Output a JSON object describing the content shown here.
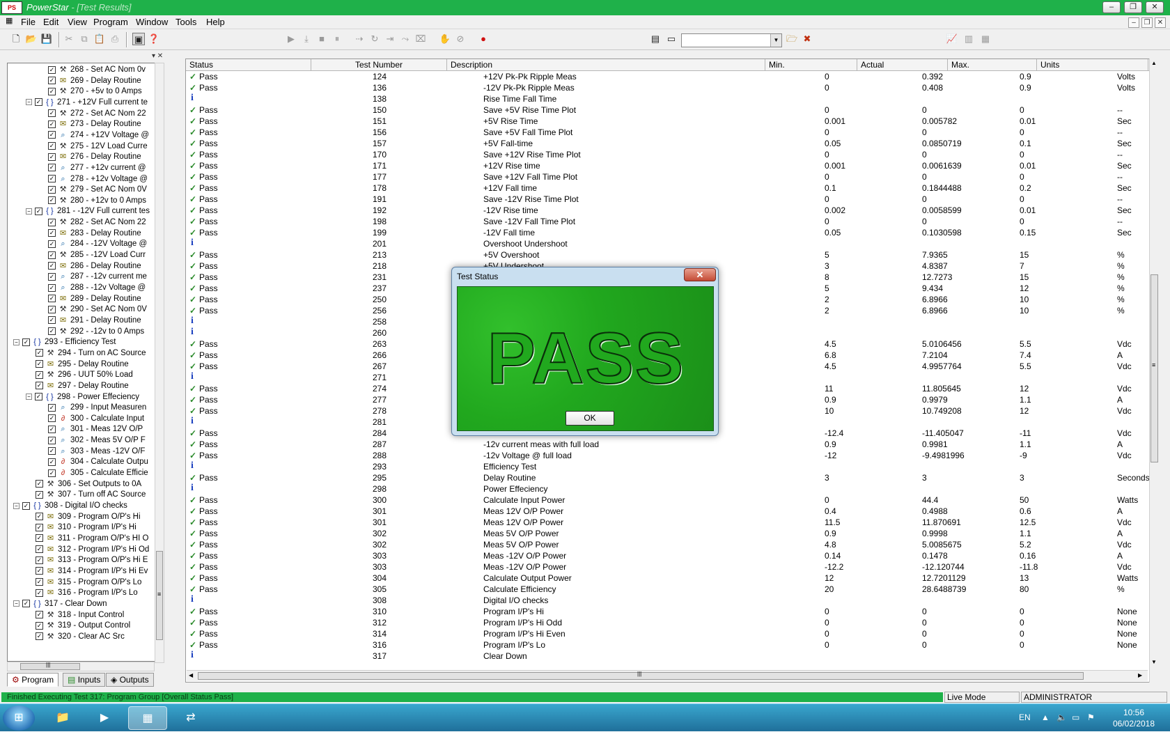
{
  "window": {
    "app_name": "PowerStar",
    "doc_title": "- [Test Results]",
    "minimize": "–",
    "restore": "❐",
    "close": "✕"
  },
  "menu": [
    "File",
    "Edit",
    "View",
    "Program",
    "Window",
    "Tools",
    "Help"
  ],
  "mdi_controls": {
    "minimize": "–",
    "restore": "❐",
    "close": "✕"
  },
  "toolbar": {
    "combo_value": "",
    "icons": [
      "new-icon",
      "open-icon",
      "save-icon",
      "cut-icon",
      "copy-icon",
      "paste-icon",
      "print-icon",
      "monitor-icon",
      "help-icon",
      "play-icon",
      "step-icon",
      "stop-icon",
      "pause-icon",
      "run-to-icon",
      "loop-icon",
      "skip-icon",
      "break-icon",
      "clear-icon",
      "hand-icon",
      "reset-icon",
      "record-icon",
      "tile-icon",
      "cascade-icon",
      "open-folder-icon",
      "delete-icon",
      "chart-icon",
      "chart2-icon",
      "chart3-icon"
    ]
  },
  "tree": {
    "items": [
      {
        "level": 2,
        "type": "set",
        "label": "268 - Set AC Nom 0v"
      },
      {
        "level": 2,
        "type": "delay",
        "label": "269 - Delay Routine"
      },
      {
        "level": 2,
        "type": "set",
        "label": "270 - +5v to 0 Amps"
      },
      {
        "level": 1,
        "type": "group",
        "label": "271 - +12V Full current te"
      },
      {
        "level": 2,
        "type": "set",
        "label": "272 - Set AC Nom 22"
      },
      {
        "level": 2,
        "type": "delay",
        "label": "273 - Delay Routine"
      },
      {
        "level": 2,
        "type": "meas",
        "label": "274 - +12V Voltage @"
      },
      {
        "level": 2,
        "type": "set",
        "label": "275 - 12V Load Curre"
      },
      {
        "level": 2,
        "type": "delay",
        "label": "276 - Delay Routine"
      },
      {
        "level": 2,
        "type": "meas",
        "label": "277 - +12v current @"
      },
      {
        "level": 2,
        "type": "meas",
        "label": "278 - +12v Voltage @"
      },
      {
        "level": 2,
        "type": "set",
        "label": "279 - Set AC Nom 0V"
      },
      {
        "level": 2,
        "type": "set",
        "label": "280 - +12v to 0 Amps"
      },
      {
        "level": 1,
        "type": "group",
        "label": "281 - -12V Full current tes"
      },
      {
        "level": 2,
        "type": "set",
        "label": "282 - Set AC Nom 22"
      },
      {
        "level": 2,
        "type": "delay",
        "label": "283 - Delay Routine"
      },
      {
        "level": 2,
        "type": "meas",
        "label": "284 - -12V Voltage @"
      },
      {
        "level": 2,
        "type": "set",
        "label": "285 - -12V Load Curr"
      },
      {
        "level": 2,
        "type": "delay",
        "label": "286 - Delay Routine"
      },
      {
        "level": 2,
        "type": "meas",
        "label": "287 - -12v current me"
      },
      {
        "level": 2,
        "type": "meas",
        "label": "288 - -12v Voltage @"
      },
      {
        "level": 2,
        "type": "delay",
        "label": "289 - Delay Routine"
      },
      {
        "level": 2,
        "type": "set",
        "label": "290 - Set AC Nom 0V"
      },
      {
        "level": 2,
        "type": "delay",
        "label": "291 - Delay Routine"
      },
      {
        "level": 2,
        "type": "set",
        "label": "292 - -12v to 0 Amps"
      },
      {
        "level": 0,
        "type": "group",
        "label": "293 - Efficiency Test"
      },
      {
        "level": 1,
        "type": "set",
        "label": "294 - Turn on AC Source"
      },
      {
        "level": 1,
        "type": "delay",
        "label": "295 - Delay Routine"
      },
      {
        "level": 1,
        "type": "set",
        "label": "296 - UUT 50% Load"
      },
      {
        "level": 1,
        "type": "delay",
        "label": "297 - Delay Routine"
      },
      {
        "level": 1,
        "type": "group",
        "label": "298 - Power Effeciency"
      },
      {
        "level": 2,
        "type": "meas",
        "label": "299 - Input Measuren"
      },
      {
        "level": 2,
        "type": "calc",
        "label": "300 - Calculate Input"
      },
      {
        "level": 2,
        "type": "meas",
        "label": "301 - Meas 12V O/P"
      },
      {
        "level": 2,
        "type": "meas",
        "label": "302 - Meas 5V O/P F"
      },
      {
        "level": 2,
        "type": "meas",
        "label": "303 - Meas -12V O/F"
      },
      {
        "level": 2,
        "type": "calc",
        "label": "304 - Calculate Outpu"
      },
      {
        "level": 2,
        "type": "calc",
        "label": "305 - Calculate Efficie"
      },
      {
        "level": 1,
        "type": "set",
        "label": "306 - Set Outputs to 0A"
      },
      {
        "level": 1,
        "type": "set",
        "label": "307 - Turn off AC Source"
      },
      {
        "level": 0,
        "type": "group",
        "label": "308 - Digital I/O checks"
      },
      {
        "level": 1,
        "type": "delay",
        "label": "309 - Program O/P's Hi"
      },
      {
        "level": 1,
        "type": "delay",
        "label": "310 - Program I/P's Hi"
      },
      {
        "level": 1,
        "type": "delay",
        "label": "311 - Program O/P's HI O"
      },
      {
        "level": 1,
        "type": "delay",
        "label": "312 - Program I/P's Hi Od"
      },
      {
        "level": 1,
        "type": "delay",
        "label": "313 - Program O/P's Hi E"
      },
      {
        "level": 1,
        "type": "delay",
        "label": "314 - Program I/P's Hi Ev"
      },
      {
        "level": 1,
        "type": "delay",
        "label": "315 - Program O/P's Lo"
      },
      {
        "level": 1,
        "type": "delay",
        "label": "316 - Program I/P's Lo"
      },
      {
        "level": 0,
        "type": "group",
        "label": "317 - Clear Down"
      },
      {
        "level": 1,
        "type": "set",
        "label": "318 - Input Control"
      },
      {
        "level": 1,
        "type": "set",
        "label": "319 - Output Control"
      },
      {
        "level": 1,
        "type": "set",
        "label": "320 - Clear AC Src"
      }
    ],
    "hscroll_grip": "|||",
    "vscroll_grip": "≡"
  },
  "tabs": [
    {
      "label": "Program",
      "icon": "program-icon"
    },
    {
      "label": "Inputs",
      "icon": "inputs-icon"
    },
    {
      "label": "Outputs",
      "icon": "outputs-icon"
    }
  ],
  "grid": {
    "columns": [
      "Status",
      "Test Number",
      "Description",
      "Min.",
      "Actual",
      "Max.",
      "Units"
    ],
    "rows": [
      {
        "s": "pass",
        "st": "Pass",
        "n": "124",
        "d": "+12V Pk-Pk Ripple Meas",
        "min": "0",
        "act": "0.392",
        "max": "0.9",
        "u": "Volts"
      },
      {
        "s": "pass",
        "st": "Pass",
        "n": "136",
        "d": "-12V Pk-Pk Ripple Meas",
        "min": "0",
        "act": "0.408",
        "max": "0.9",
        "u": "Volts"
      },
      {
        "s": "info",
        "st": "",
        "n": "138",
        "d": "Rise Time Fall Time",
        "min": "",
        "act": "",
        "max": "",
        "u": ""
      },
      {
        "s": "pass",
        "st": "Pass",
        "n": "150",
        "d": "Save +5V Rise Time Plot",
        "min": "0",
        "act": "0",
        "max": "0",
        "u": "--"
      },
      {
        "s": "pass",
        "st": "Pass",
        "n": "151",
        "d": "+5V Rise Time",
        "min": "0.001",
        "act": "0.005782",
        "max": "0.01",
        "u": "Sec"
      },
      {
        "s": "pass",
        "st": "Pass",
        "n": "156",
        "d": "Save +5V Fall Time Plot",
        "min": "0",
        "act": "0",
        "max": "0",
        "u": "--"
      },
      {
        "s": "pass",
        "st": "Pass",
        "n": "157",
        "d": "+5V Fall-time",
        "min": "0.05",
        "act": "0.0850719",
        "max": "0.1",
        "u": "Sec"
      },
      {
        "s": "pass",
        "st": "Pass",
        "n": "170",
        "d": "Save +12V Rise Time Plot",
        "min": "0",
        "act": "0",
        "max": "0",
        "u": "--"
      },
      {
        "s": "pass",
        "st": "Pass",
        "n": "171",
        "d": "+12V Rise time",
        "min": "0.001",
        "act": "0.0061639",
        "max": "0.01",
        "u": "Sec"
      },
      {
        "s": "pass",
        "st": "Pass",
        "n": "177",
        "d": "Save +12V Fall Time Plot",
        "min": "0",
        "act": "0",
        "max": "0",
        "u": "--"
      },
      {
        "s": "pass",
        "st": "Pass",
        "n": "178",
        "d": "+12V Fall time",
        "min": "0.1",
        "act": "0.1844488",
        "max": "0.2",
        "u": "Sec"
      },
      {
        "s": "pass",
        "st": "Pass",
        "n": "191",
        "d": "Save -12V Rise Time Plot",
        "min": "0",
        "act": "0",
        "max": "0",
        "u": "--"
      },
      {
        "s": "pass",
        "st": "Pass",
        "n": "192",
        "d": "-12V Rise time",
        "min": "0.002",
        "act": "0.0058599",
        "max": "0.01",
        "u": "Sec"
      },
      {
        "s": "pass",
        "st": "Pass",
        "n": "198",
        "d": "Save -12V Fall Time Plot",
        "min": "0",
        "act": "0",
        "max": "0",
        "u": "--"
      },
      {
        "s": "pass",
        "st": "Pass",
        "n": "199",
        "d": "-12V Fall time",
        "min": "0.05",
        "act": "0.1030598",
        "max": "0.15",
        "u": "Sec"
      },
      {
        "s": "info",
        "st": "",
        "n": "201",
        "d": "Overshoot Undershoot",
        "min": "",
        "act": "",
        "max": "",
        "u": ""
      },
      {
        "s": "pass",
        "st": "Pass",
        "n": "213",
        "d": "+5V Overshoot",
        "min": "5",
        "act": "7.9365",
        "max": "15",
        "u": "%"
      },
      {
        "s": "pass",
        "st": "Pass",
        "n": "218",
        "d": "+5V Undershoot",
        "min": "3",
        "act": "4.8387",
        "max": "7",
        "u": "%"
      },
      {
        "s": "pass",
        "st": "Pass",
        "n": "231",
        "d": "",
        "min": "8",
        "act": "12.7273",
        "max": "15",
        "u": "%"
      },
      {
        "s": "pass",
        "st": "Pass",
        "n": "237",
        "d": "",
        "min": "5",
        "act": "9.434",
        "max": "12",
        "u": "%"
      },
      {
        "s": "pass",
        "st": "Pass",
        "n": "250",
        "d": "",
        "min": "2",
        "act": "6.8966",
        "max": "10",
        "u": "%"
      },
      {
        "s": "pass",
        "st": "Pass",
        "n": "256",
        "d": "",
        "min": "2",
        "act": "6.8966",
        "max": "10",
        "u": "%"
      },
      {
        "s": "info",
        "st": "",
        "n": "258",
        "d": "",
        "min": "",
        "act": "",
        "max": "",
        "u": ""
      },
      {
        "s": "info",
        "st": "",
        "n": "260",
        "d": "",
        "min": "",
        "act": "",
        "max": "",
        "u": ""
      },
      {
        "s": "pass",
        "st": "Pass",
        "n": "263",
        "d": "",
        "min": "4.5",
        "act": "5.0106456",
        "max": "5.5",
        "u": "Vdc"
      },
      {
        "s": "pass",
        "st": "Pass",
        "n": "266",
        "d": "",
        "min": "6.8",
        "act": "7.2104",
        "max": "7.4",
        "u": "A"
      },
      {
        "s": "pass",
        "st": "Pass",
        "n": "267",
        "d": "",
        "min": "4.5",
        "act": "4.9957764",
        "max": "5.5",
        "u": "Vdc"
      },
      {
        "s": "info",
        "st": "",
        "n": "271",
        "d": "",
        "min": "",
        "act": "",
        "max": "",
        "u": ""
      },
      {
        "s": "pass",
        "st": "Pass",
        "n": "274",
        "d": "",
        "min": "11",
        "act": "11.805645",
        "max": "12",
        "u": "Vdc"
      },
      {
        "s": "pass",
        "st": "Pass",
        "n": "277",
        "d": "",
        "min": "0.9",
        "act": "0.9979",
        "max": "1.1",
        "u": "A"
      },
      {
        "s": "pass",
        "st": "Pass",
        "n": "278",
        "d": "",
        "min": "10",
        "act": "10.749208",
        "max": "12",
        "u": "Vdc"
      },
      {
        "s": "info",
        "st": "",
        "n": "281",
        "d": "",
        "min": "",
        "act": "",
        "max": "",
        "u": ""
      },
      {
        "s": "pass",
        "st": "Pass",
        "n": "284",
        "d": "",
        "min": "-12.4",
        "act": "-11.405047",
        "max": "-11",
        "u": "Vdc"
      },
      {
        "s": "pass",
        "st": "Pass",
        "n": "287",
        "d": "-12v current meas with full load",
        "min": "0.9",
        "act": "0.9981",
        "max": "1.1",
        "u": "A"
      },
      {
        "s": "pass",
        "st": "Pass",
        "n": "288",
        "d": "-12v Voltage @ full load",
        "min": "-12",
        "act": "-9.4981996",
        "max": "-9",
        "u": "Vdc"
      },
      {
        "s": "info",
        "st": "",
        "n": "293",
        "d": "Efficiency Test",
        "min": "",
        "act": "",
        "max": "",
        "u": ""
      },
      {
        "s": "pass",
        "st": "Pass",
        "n": "295",
        "d": "Delay Routine",
        "min": "3",
        "act": "3",
        "max": "3",
        "u": "Seconds"
      },
      {
        "s": "info",
        "st": "",
        "n": "298",
        "d": "Power Effeciency",
        "min": "",
        "act": "",
        "max": "",
        "u": ""
      },
      {
        "s": "pass",
        "st": "Pass",
        "n": "300",
        "d": "Calculate Input  Power",
        "min": "0",
        "act": "44.4",
        "max": "50",
        "u": "Watts"
      },
      {
        "s": "pass",
        "st": "Pass",
        "n": "301",
        "d": "Meas 12V O/P Power",
        "min": "0.4",
        "act": "0.4988",
        "max": "0.6",
        "u": "A"
      },
      {
        "s": "pass",
        "st": "Pass",
        "n": "301",
        "d": "Meas 12V O/P Power",
        "min": "11.5",
        "act": "11.870691",
        "max": "12.5",
        "u": "Vdc"
      },
      {
        "s": "pass",
        "st": "Pass",
        "n": "302",
        "d": "Meas 5V O/P Power",
        "min": "0.9",
        "act": "0.9998",
        "max": "1.1",
        "u": "A"
      },
      {
        "s": "pass",
        "st": "Pass",
        "n": "302",
        "d": "Meas 5V O/P Power",
        "min": "4.8",
        "act": "5.0085675",
        "max": "5.2",
        "u": "Vdc"
      },
      {
        "s": "pass",
        "st": "Pass",
        "n": "303",
        "d": "Meas -12V O/P Power",
        "min": "0.14",
        "act": "0.1478",
        "max": "0.16",
        "u": "A"
      },
      {
        "s": "pass",
        "st": "Pass",
        "n": "303",
        "d": "Meas -12V O/P Power",
        "min": "-12.2",
        "act": "-12.120744",
        "max": "-11.8",
        "u": "Vdc"
      },
      {
        "s": "pass",
        "st": "Pass",
        "n": "304",
        "d": "Calculate Output Power",
        "min": "12",
        "act": "12.7201129",
        "max": "13",
        "u": "Watts"
      },
      {
        "s": "pass",
        "st": "Pass",
        "n": "305",
        "d": "Calculate Efficiency",
        "min": "20",
        "act": "28.6488739",
        "max": "80",
        "u": "%"
      },
      {
        "s": "info",
        "st": "",
        "n": "308",
        "d": "Digital I/O checks",
        "min": "",
        "act": "",
        "max": "",
        "u": ""
      },
      {
        "s": "pass",
        "st": "Pass",
        "n": "310",
        "d": "Program I/P's Hi",
        "min": "0",
        "act": "0",
        "max": "0",
        "u": "None"
      },
      {
        "s": "pass",
        "st": "Pass",
        "n": "312",
        "d": "Program I/P's Hi Odd",
        "min": "0",
        "act": "0",
        "max": "0",
        "u": "None"
      },
      {
        "s": "pass",
        "st": "Pass",
        "n": "314",
        "d": "Program I/P's Hi Even",
        "min": "0",
        "act": "0",
        "max": "0",
        "u": "None"
      },
      {
        "s": "pass",
        "st": "Pass",
        "n": "316",
        "d": "Program I/P's Lo",
        "min": "0",
        "act": "0",
        "max": "0",
        "u": "None"
      },
      {
        "s": "info",
        "st": "",
        "n": "317",
        "d": "Clear Down",
        "min": "",
        "act": "",
        "max": "",
        "u": ""
      }
    ],
    "hscroll_grip": "|||",
    "vscroll_grip": "≡"
  },
  "dialog": {
    "title": "Test Status",
    "close": "✕",
    "result_text": "PASS",
    "ok_label": "OK"
  },
  "statusbar": {
    "message": "Finished Executing Test 317: Program Group [Overall Status Pass]",
    "mode": "Live Mode",
    "user": "ADMINISTRATOR"
  },
  "taskbar": {
    "start": "⊞",
    "apps": [
      "explorer-icon",
      "media-player-icon",
      "powerstar-icon",
      "remote-icon"
    ],
    "language": "EN",
    "time": "10:56",
    "date": "06/02/2018"
  },
  "colors": {
    "accent_green": "#1fb14a",
    "pass_green": "#2a8a2a",
    "info_blue": "#1a3fbf",
    "dialog_green": "#21a81e"
  }
}
